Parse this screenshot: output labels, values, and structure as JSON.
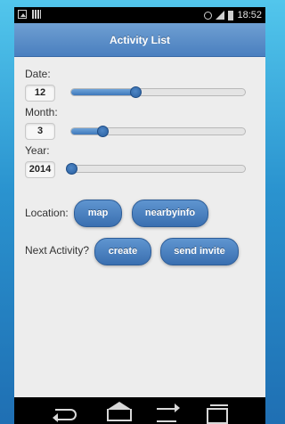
{
  "status_bar": {
    "time": "18:52",
    "icons_left": [
      "image-icon",
      "barcode-icon"
    ],
    "icons_right": [
      "alarm-icon",
      "signal-icon",
      "battery-icon"
    ]
  },
  "header": {
    "title": "Activity List"
  },
  "form": {
    "date": {
      "label": "Date:",
      "value": "12",
      "slider_fraction": 0.37
    },
    "month": {
      "label": "Month:",
      "value": "3",
      "slider_fraction": 0.18
    },
    "year": {
      "label": "Year:",
      "value": "2014",
      "slider_fraction": 0.0
    }
  },
  "location": {
    "label": "Location:",
    "map_button": "map",
    "nearby_button": "nearbyinfo"
  },
  "next_activity": {
    "label": "Next Activity?",
    "create_button": "create",
    "invite_button": "send invite"
  },
  "nav_bar": {
    "icons": [
      "back-icon",
      "home-icon",
      "switch-icon",
      "recent-apps-icon"
    ]
  },
  "colors": {
    "accent": "#4a7fbf",
    "button": "#3a6fb0",
    "background": "#ededed"
  }
}
